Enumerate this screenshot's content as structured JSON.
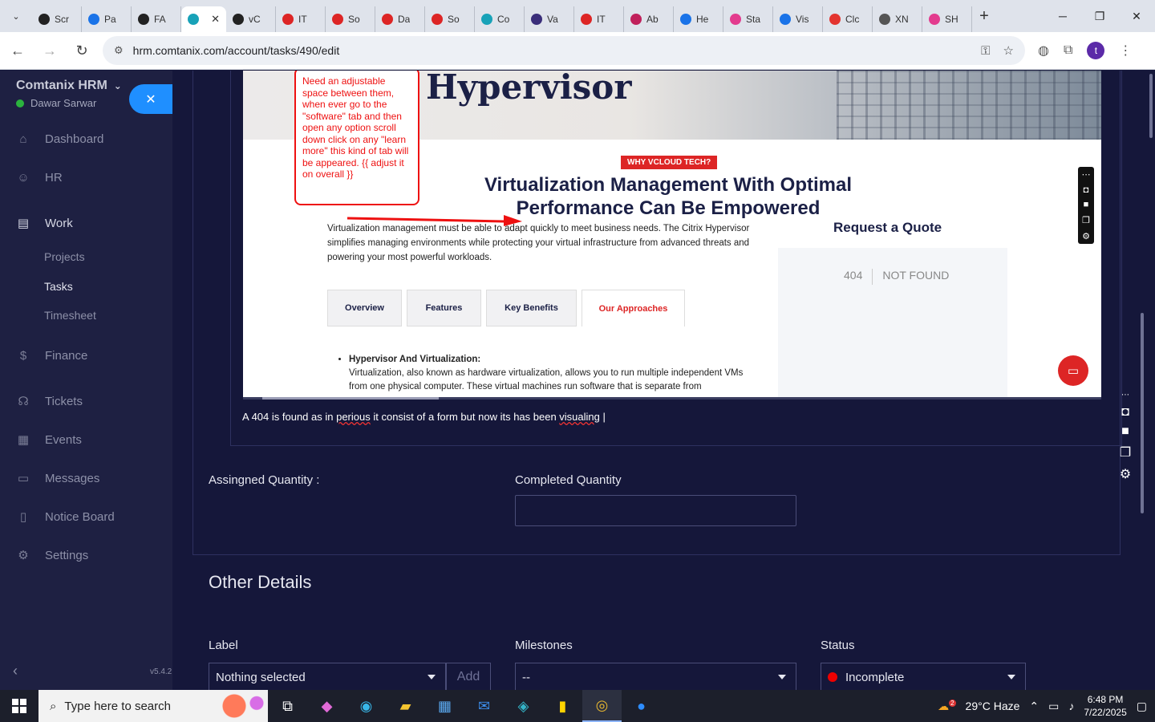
{
  "browser": {
    "tabs": [
      {
        "label": "Scr",
        "color": "#222"
      },
      {
        "label": "Pa",
        "color": "#1a73e8"
      },
      {
        "label": "FA",
        "color": "#222"
      },
      {
        "label": "",
        "color": "#18a2b8",
        "active": true
      },
      {
        "label": "vC",
        "color": "#222"
      },
      {
        "label": "IT",
        "color": "#dd2525"
      },
      {
        "label": "So",
        "color": "#dd2525"
      },
      {
        "label": "Da",
        "color": "#dd2525"
      },
      {
        "label": "So",
        "color": "#dd2525"
      },
      {
        "label": "Co",
        "color": "#18a2b8"
      },
      {
        "label": "Va",
        "color": "#3a2e7a"
      },
      {
        "label": "IT",
        "color": "#dd2525"
      },
      {
        "label": "Ab",
        "color": "#c0205b"
      },
      {
        "label": "He",
        "color": "#1a73e8"
      },
      {
        "label": "Sta",
        "color": "#e33b8e"
      },
      {
        "label": "Vis",
        "color": "#1a73e8"
      },
      {
        "label": "Clc",
        "color": "#e3342f"
      },
      {
        "label": "XN",
        "color": "#555"
      },
      {
        "label": "SH",
        "color": "#e33b8e"
      }
    ],
    "close_glyph": "✕",
    "new_tab": "+",
    "url": "hrm.comtanix.com/account/tasks/490/edit",
    "profile_initial": "t"
  },
  "sidebar": {
    "brand": "Comtanix HRM",
    "user": "Dawar Sarwar",
    "close_glyph": "✕",
    "items": [
      {
        "label": "Dashboard",
        "icon": "⌂"
      },
      {
        "label": "HR",
        "icon": "☺"
      },
      {
        "label": "Work",
        "icon": "▤"
      },
      {
        "label": "Finance",
        "icon": "$"
      },
      {
        "label": "Tickets",
        "icon": "☊"
      },
      {
        "label": "Events",
        "icon": "▦"
      },
      {
        "label": "Messages",
        "icon": "▭"
      },
      {
        "label": "Notice Board",
        "icon": "▯"
      },
      {
        "label": "Settings",
        "icon": "⚙"
      }
    ],
    "sub_items": [
      "Projects",
      "Tasks",
      "Timesheet"
    ],
    "version": "v5.4.2",
    "collapse_glyph": "‹"
  },
  "screenshot": {
    "heading": "Hypervisor",
    "note": "Need an adjustable space between them, when ever go to the \"software\" tab and then open any option scroll down click on any \"learn more\" this kind of tab will be appeared. {{ adjust it on overall }}",
    "badge": "WHY VCLOUD TECH?",
    "title": "Virtualization Management With Optimal Performance Can Be Empowered",
    "paragraph": "Virtualization management must be able to adapt quickly to meet business needs. The Citrix Hypervisor simplifies managing environments while protecting your virtual infrastructure from advanced threats and powering your most powerful workloads.",
    "tabs": [
      "Overview",
      "Features",
      "Key Benefits",
      "Our Approaches"
    ],
    "bullet_title": "Hypervisor And Virtualization:",
    "bullet_text": "Virtualization, also known as hardware virtualization, allows you to run multiple independent VMs from one physical computer. These virtual machines run software that is separate from",
    "quote_title": "Request a Quote",
    "nf_code": "404",
    "nf_text": "NOT FOUND"
  },
  "editor": {
    "text_pre": "A 404 is found as in ",
    "text_sq1": "perious",
    "text_mid": " it consist of a form but now its has been ",
    "text_sq2": "visualing"
  },
  "form": {
    "assigned_label": "Assingned Quantity :",
    "completed_label": "Completed Quantity",
    "other_details": "Other Details",
    "label_label": "Label",
    "label_value": "Nothing selected",
    "add_label": "Add",
    "milestones_label": "Milestones",
    "milestones_value": "--",
    "status_label": "Status",
    "status_value": "Incomplete",
    "status_color": "#ee0000"
  },
  "taskbar": {
    "search_placeholder": "Type here to search",
    "weather": "29°C  Haze",
    "weather_badge": "2",
    "time": "6:48 PM",
    "date": "7/22/2025"
  }
}
